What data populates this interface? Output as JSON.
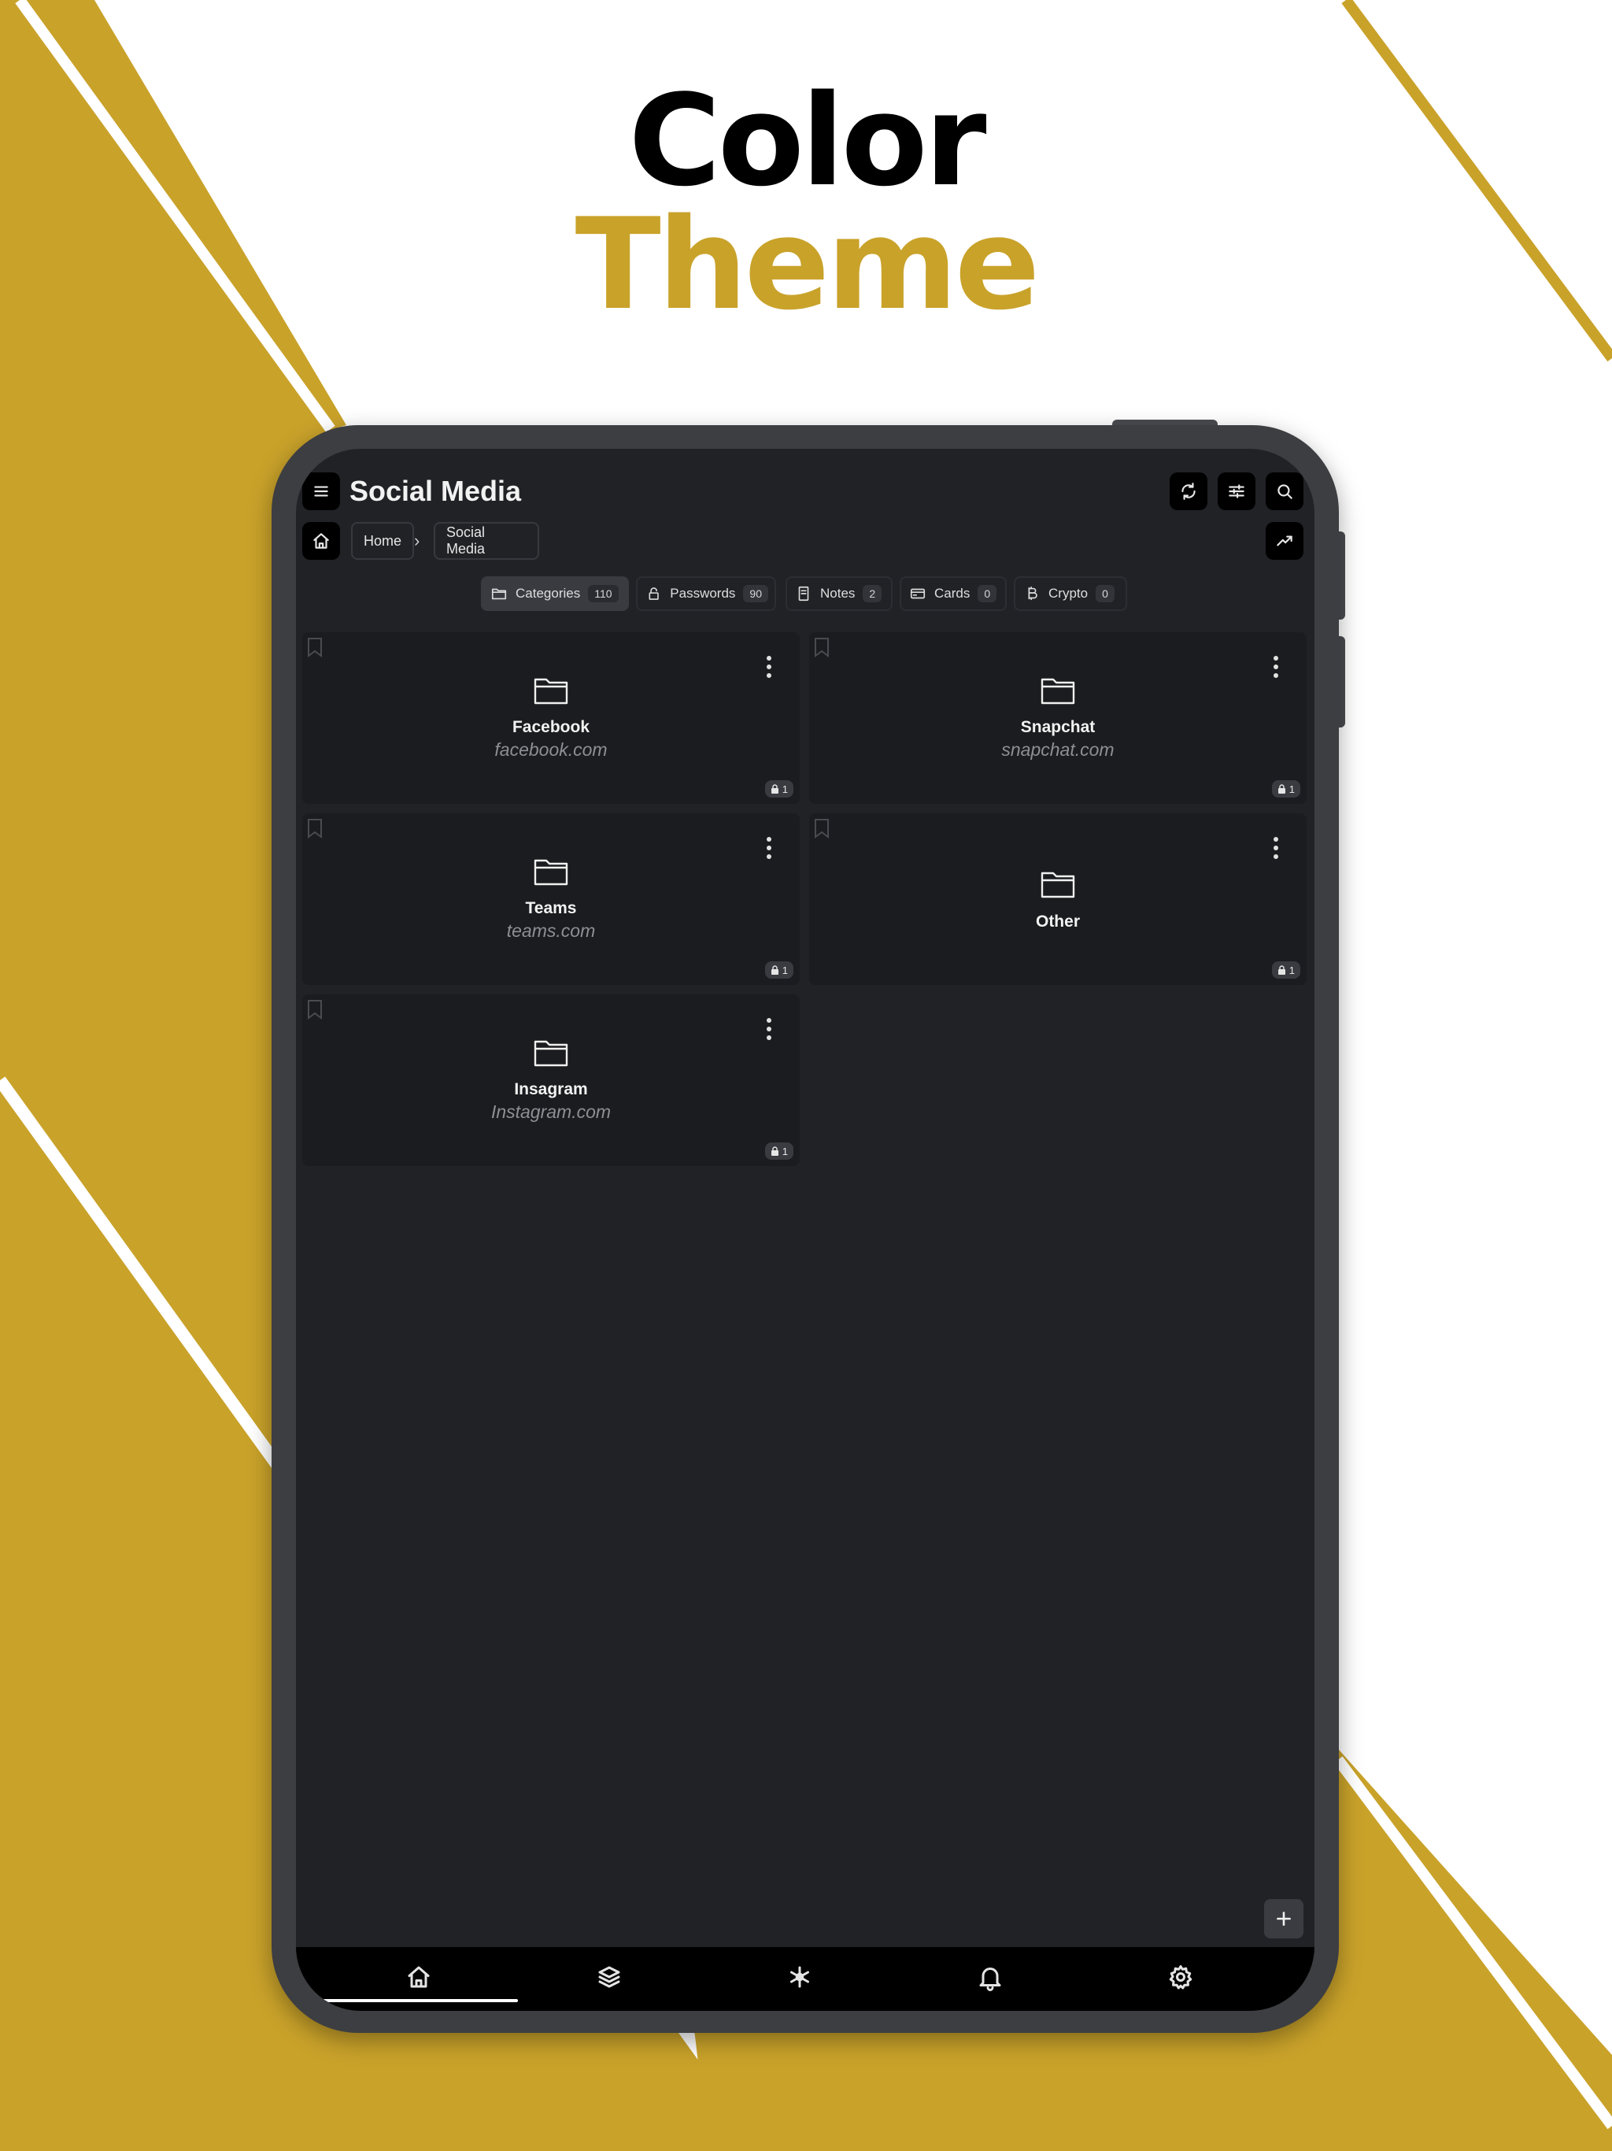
{
  "hero": {
    "line1": "Color",
    "line2": "Theme"
  },
  "colors": {
    "accent": "#c9a22a",
    "screen_bg": "#212226",
    "card_bg": "#1b1c1f"
  },
  "header": {
    "title": "Social Media",
    "menu_icon": "hamburger-icon",
    "actions": [
      "sync-icon",
      "filter-sliders-icon",
      "search-icon"
    ],
    "trend_icon": "trending-up-icon"
  },
  "breadcrumb": {
    "home_icon": "home-icon",
    "items": [
      "Home",
      "Social Media"
    ],
    "separator": "›"
  },
  "tabs": [
    {
      "label": "Categories",
      "count": "110",
      "icon": "folder-icon",
      "active": true
    },
    {
      "label": "Passwords",
      "count": "90",
      "icon": "lock-icon",
      "active": false
    },
    {
      "label": "Notes",
      "count": "2",
      "icon": "note-icon",
      "active": false
    },
    {
      "label": "Cards",
      "count": "0",
      "icon": "card-icon",
      "active": false
    },
    {
      "label": "Crypto",
      "count": "0",
      "icon": "bitcoin-icon",
      "active": false
    }
  ],
  "categories": [
    {
      "name": "Facebook",
      "url": "facebook.com",
      "count": "1"
    },
    {
      "name": "Snapchat",
      "url": "snapchat.com",
      "count": "1"
    },
    {
      "name": "Teams",
      "url": "teams.com",
      "count": "1"
    },
    {
      "name": "Other",
      "url": "",
      "count": "1"
    },
    {
      "name": "Insagram",
      "url": "Instagram.com",
      "count": "1"
    }
  ],
  "bottom_nav": [
    {
      "name": "home",
      "icon": "home-icon",
      "active": true
    },
    {
      "name": "layers",
      "icon": "layers-icon",
      "active": false
    },
    {
      "name": "generator",
      "icon": "asterisk-icon",
      "active": false
    },
    {
      "name": "notifications",
      "icon": "bell-icon",
      "active": false
    },
    {
      "name": "settings",
      "icon": "gear-icon",
      "active": false
    }
  ]
}
